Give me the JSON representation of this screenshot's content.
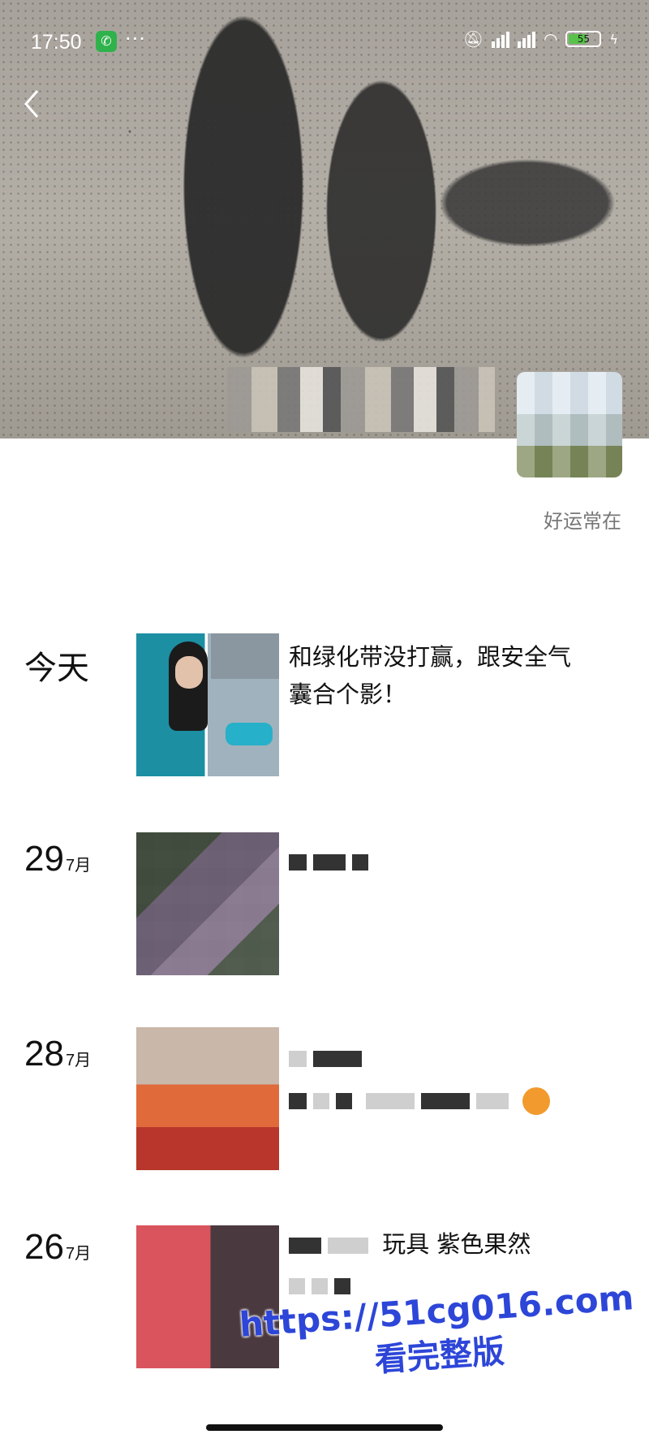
{
  "status_bar": {
    "time": "17:50",
    "more": "···",
    "battery": "55"
  },
  "profile": {
    "signature": "好运常在"
  },
  "entries": [
    {
      "date_label": "今天",
      "text_line1": "和绿化带没打赢，跟安全气",
      "text_line2": "囊合个影！"
    },
    {
      "day": "29",
      "month": "7月"
    },
    {
      "day": "28",
      "month": "7月"
    },
    {
      "day": "26",
      "month": "7月",
      "text_visible": "玩具 紫色果然"
    }
  ],
  "watermark": {
    "url": "https://51cg016.com",
    "subtitle": "看完整版"
  },
  "icons": {
    "back": "back-chevron-icon",
    "call": "phone-call-icon",
    "signal": "signal-icon",
    "wifi": "wifi-icon",
    "battery": "battery-icon"
  },
  "colors": {
    "call_green": "#2fb24c",
    "battery_green": "#58c24a",
    "watermark_blue": "#2d46d8"
  }
}
